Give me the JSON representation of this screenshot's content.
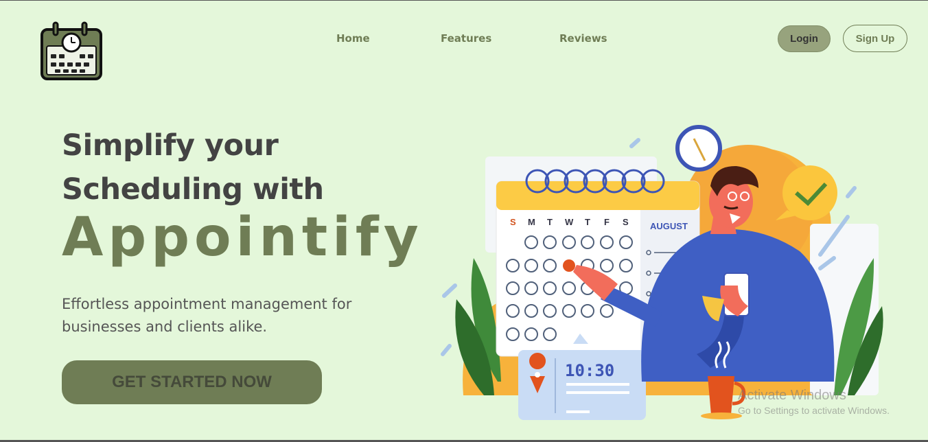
{
  "nav": {
    "links": [
      "Home",
      "Features",
      "Reviews"
    ],
    "login": "Login",
    "signup": "Sign Up"
  },
  "hero": {
    "line1": "Simplify your",
    "line2": "Scheduling with",
    "brand": "Appointify",
    "subtitle": "Effortless appointment management for businesses and clients alike.",
    "cta": "GET STARTED NOW"
  },
  "illustration": {
    "weekdays": [
      "S",
      "M",
      "T",
      "W",
      "T",
      "F",
      "S"
    ],
    "month": "AUGUST",
    "time": "10:30"
  },
  "watermark": {
    "line1": "Activate Windows",
    "line2": "Go to Settings to activate Windows."
  },
  "colors": {
    "background": "#e4f7da",
    "brand": "#6f7d55",
    "heading": "#434343"
  }
}
